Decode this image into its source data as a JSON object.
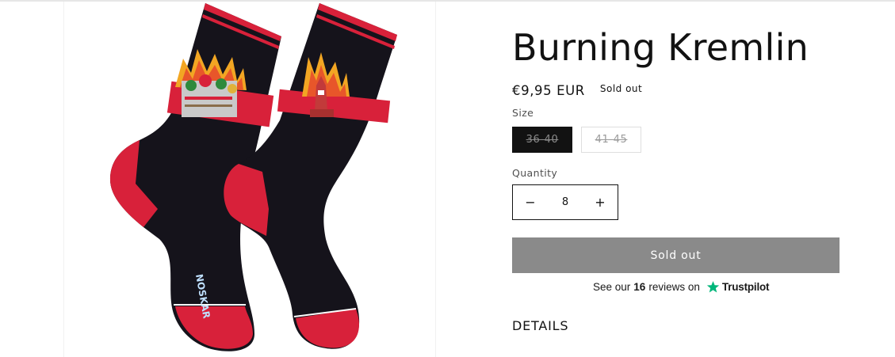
{
  "product": {
    "title": "Burning Kremlin",
    "price": "€9,95 EUR",
    "badge": "Sold out",
    "image_alt_brand": "NOSKAR",
    "size_label": "Size",
    "sizes": [
      "36-40",
      "41-45"
    ],
    "selected_size": "36-40",
    "quantity_label": "Quantity",
    "quantity": "8",
    "decrease_symbol": "−",
    "increase_symbol": "+",
    "buy_button_label": "Sold out",
    "details_label": "DETAILS"
  },
  "trustpilot": {
    "prefix": "See our",
    "count": "16",
    "suffix": "reviews on",
    "brand": "Trustpilot",
    "star_color": "#00b67a"
  },
  "colors": {
    "sock_body": "#15131b",
    "sock_accent": "#d8213a",
    "button_disabled": "#8a8a8a",
    "text": "#121212"
  }
}
